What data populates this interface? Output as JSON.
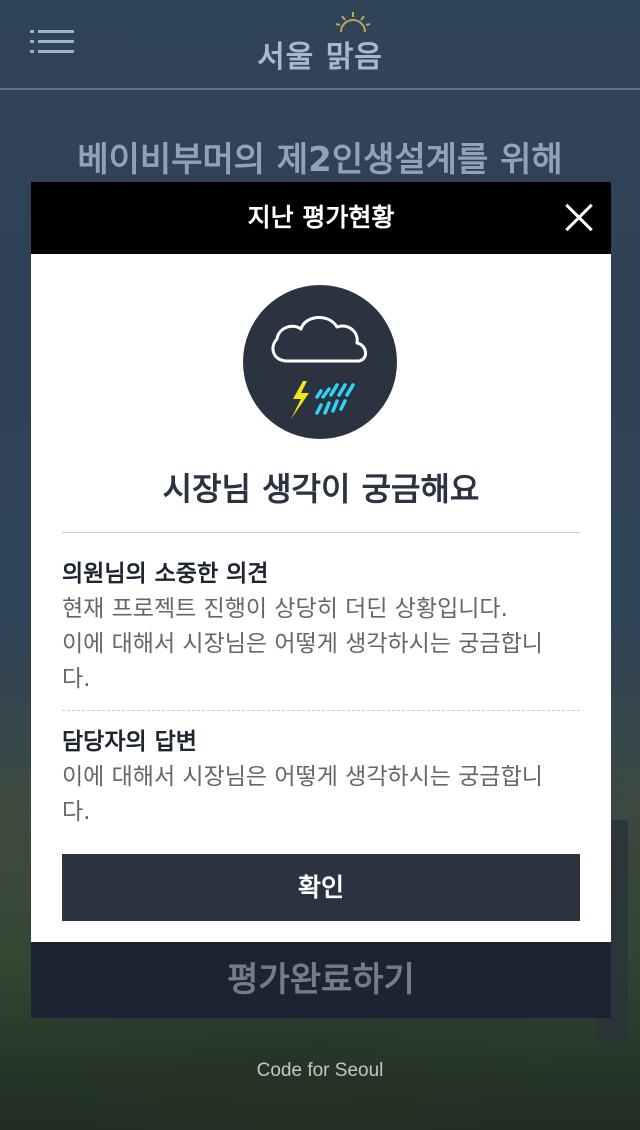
{
  "app": {
    "title": "서울 맑음"
  },
  "background": {
    "subtitle": "베이비부머의 제2인생설계를 위해",
    "footer": "Code for Seoul",
    "complete_button": "평가완료하기"
  },
  "modal": {
    "title": "지난 평가현황",
    "weather_icon": "thunderstorm-cloud-icon",
    "status_title": "시장님 생각이 궁금해요",
    "sections": [
      {
        "heading": "의원님의 소중한 의견",
        "lines": [
          "현재 프로젝트 진행이 상당히 더딘 상황입니다.",
          "이에 대해서 시장님은 어떻게 생각하시는 궁금합니",
          "다."
        ]
      },
      {
        "heading": "담당자의 답변",
        "lines": [
          "이에 대해서 시장님은 어떻게 생각하시는 궁금합니",
          "다."
        ]
      }
    ],
    "confirm_label": "확인"
  },
  "colors": {
    "modal_header": "#000000",
    "accent_dark": "#2b3240",
    "lightning": "#f5e51e",
    "rain": "#2fd3f5"
  }
}
